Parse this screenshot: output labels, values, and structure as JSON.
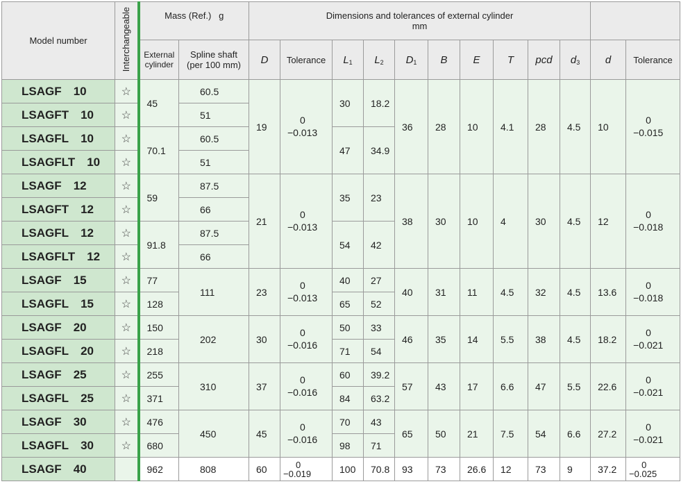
{
  "headers": {
    "model": "Model number",
    "interchangeable": "Interchangeable",
    "mass": "Mass (Ref.)   g",
    "mass_external": "External cylinder",
    "mass_spline": "Spline shaft (per 100 mm)",
    "dims_title": "Dimensions and tolerances of external cylinder",
    "dims_unit": "mm",
    "D": "D",
    "tolerance": "Tolerance",
    "L1": "L",
    "L1_sub": "1",
    "L2": "L",
    "L2_sub": "2",
    "D1": "D",
    "D1_sub": "1",
    "B": "B",
    "E": "E",
    "T": "T",
    "pcd": "pcd",
    "d3": "d",
    "d3_sub": "3",
    "d": "d",
    "tolerance2": "Tolerance"
  },
  "star": "☆",
  "models": [
    {
      "name": "LSAGF",
      "size": "10"
    },
    {
      "name": "LSAGFT",
      "size": "10"
    },
    {
      "name": "LSAGFL",
      "size": "10"
    },
    {
      "name": "LSAGFLT",
      "size": "10"
    },
    {
      "name": "LSAGF",
      "size": "12"
    },
    {
      "name": "LSAGFT",
      "size": "12"
    },
    {
      "name": "LSAGFL",
      "size": "12"
    },
    {
      "name": "LSAGFLT",
      "size": "12"
    },
    {
      "name": "LSAGF",
      "size": "15"
    },
    {
      "name": "LSAGFL",
      "size": "15"
    },
    {
      "name": "LSAGF",
      "size": "20"
    },
    {
      "name": "LSAGFL",
      "size": "20"
    },
    {
      "name": "LSAGF",
      "size": "25"
    },
    {
      "name": "LSAGFL",
      "size": "25"
    },
    {
      "name": "LSAGF",
      "size": "30"
    },
    {
      "name": "LSAGFL",
      "size": "30"
    },
    {
      "name": "LSAGF",
      "size": "40"
    }
  ],
  "groups": {
    "g10": {
      "ext": [
        "45",
        "70.1"
      ],
      "spline": [
        "60.5",
        "51",
        "60.5",
        "51"
      ],
      "D": "19",
      "tol_top": "0",
      "tol_bot": "−0.013",
      "L1": [
        "30",
        "47"
      ],
      "L2": [
        "18.2",
        "34.9"
      ],
      "D1": "36",
      "B": "28",
      "E": "10",
      "T": "4.1",
      "pcd": "28",
      "d3": "4.5",
      "d": "10",
      "tol2_top": "0",
      "tol2_bot": "−0.015"
    },
    "g12": {
      "ext": [
        "59",
        "91.8"
      ],
      "spline": [
        "87.5",
        "66",
        "87.5",
        "66"
      ],
      "D": "21",
      "tol_top": "0",
      "tol_bot": "−0.013",
      "L1": [
        "35",
        "54"
      ],
      "L2": [
        "23",
        "42"
      ],
      "D1": "38",
      "B": "30",
      "E": "10",
      "T": "4",
      "pcd": "30",
      "d3": "4.5",
      "d": "12",
      "tol2_top": "0",
      "tol2_bot": "−0.018"
    },
    "g15": {
      "ext": [
        "77",
        "128"
      ],
      "spline": "111",
      "D": "23",
      "tol_top": "0",
      "tol_bot": "−0.013",
      "L1": [
        "40",
        "65"
      ],
      "L2": [
        "27",
        "52"
      ],
      "D1": "40",
      "B": "31",
      "E": "11",
      "T": "4.5",
      "pcd": "32",
      "d3": "4.5",
      "d": "13.6",
      "tol2_top": "0",
      "tol2_bot": "−0.018"
    },
    "g20": {
      "ext": [
        "150",
        "218"
      ],
      "spline": "202",
      "D": "30",
      "tol_top": "0",
      "tol_bot": "−0.016",
      "L1": [
        "50",
        "71"
      ],
      "L2": [
        "33",
        "54"
      ],
      "D1": "46",
      "B": "35",
      "E": "14",
      "T": "5.5",
      "pcd": "38",
      "d3": "4.5",
      "d": "18.2",
      "tol2_top": "0",
      "tol2_bot": "−0.021"
    },
    "g25": {
      "ext": [
        "255",
        "371"
      ],
      "spline": "310",
      "D": "37",
      "tol_top": "0",
      "tol_bot": "−0.016",
      "L1": [
        "60",
        "84"
      ],
      "L2": [
        "39.2",
        "63.2"
      ],
      "D1": "57",
      "B": "43",
      "E": "17",
      "T": "6.6",
      "pcd": "47",
      "d3": "5.5",
      "d": "22.6",
      "tol2_top": "0",
      "tol2_bot": "−0.021"
    },
    "g30": {
      "ext": [
        "476",
        "680"
      ],
      "spline": "450",
      "D": "45",
      "tol_top": "0",
      "tol_bot": "−0.016",
      "L1": [
        "70",
        "98"
      ],
      "L2": [
        "43",
        "71"
      ],
      "D1": "65",
      "B": "50",
      "E": "21",
      "T": "7.5",
      "pcd": "54",
      "d3": "6.6",
      "d": "27.2",
      "tol2_top": "0",
      "tol2_bot": "−0.021"
    },
    "g40": {
      "ext": "962",
      "spline": "808",
      "D": "60",
      "tol_top": "0",
      "tol_bot": "−0.019",
      "L1": "100",
      "L2": "70.8",
      "D1": "93",
      "B": "73",
      "E": "26.6",
      "T": "12",
      "pcd": "73",
      "d3": "9",
      "d": "37.2",
      "tol2_top": "0",
      "tol2_bot": "−0.025"
    }
  }
}
